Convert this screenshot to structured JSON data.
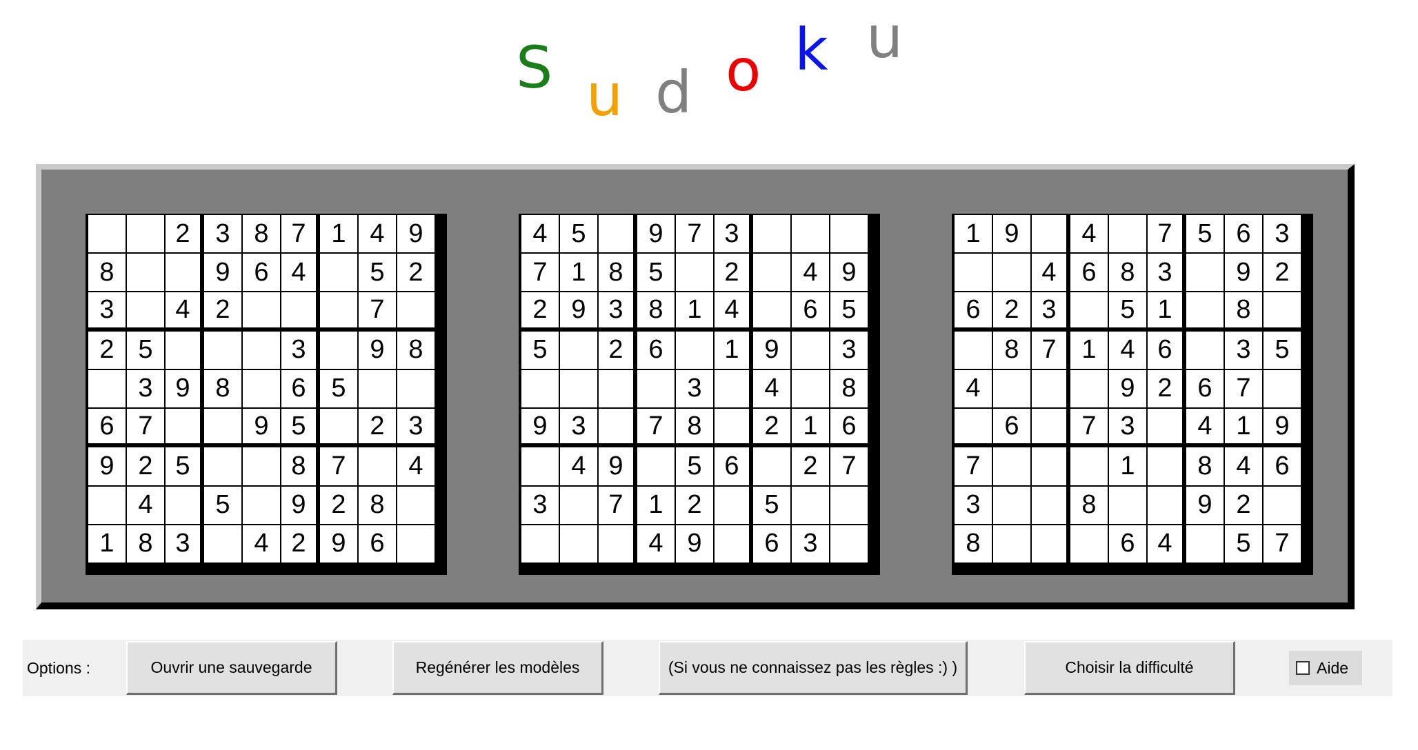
{
  "title": {
    "letters": [
      {
        "char": "S",
        "color": "#1a7f1a"
      },
      {
        "char": "u",
        "color": "#f5a000"
      },
      {
        "char": "d",
        "color": "#808080"
      },
      {
        "char": "o",
        "color": "#ee0000"
      },
      {
        "char": "k",
        "color": "#0a14ee"
      },
      {
        "char": "u",
        "color": "#808080"
      }
    ]
  },
  "grids": [
    [
      [
        "",
        "",
        "2",
        "3",
        "8",
        "7",
        "1",
        "4",
        "9"
      ],
      [
        "8",
        "",
        "",
        "9",
        "6",
        "4",
        "",
        "5",
        "2"
      ],
      [
        "3",
        "",
        "4",
        "2",
        "",
        "",
        "",
        "7",
        ""
      ],
      [
        "2",
        "5",
        "",
        "",
        "",
        "3",
        "",
        "9",
        "8"
      ],
      [
        "",
        "3",
        "9",
        "8",
        "",
        "6",
        "5",
        "",
        ""
      ],
      [
        "6",
        "7",
        "",
        "",
        "9",
        "5",
        "",
        "2",
        "3"
      ],
      [
        "9",
        "2",
        "5",
        "",
        "",
        "8",
        "7",
        "",
        "4"
      ],
      [
        "",
        "4",
        "",
        "5",
        "",
        "9",
        "2",
        "8",
        ""
      ],
      [
        "1",
        "8",
        "3",
        "",
        "4",
        "2",
        "9",
        "6",
        ""
      ]
    ],
    [
      [
        "4",
        "5",
        "",
        "9",
        "7",
        "3",
        "",
        "",
        ""
      ],
      [
        "7",
        "1",
        "8",
        "5",
        "",
        "2",
        "",
        "4",
        "9"
      ],
      [
        "2",
        "9",
        "3",
        "8",
        "1",
        "4",
        "",
        "6",
        "5"
      ],
      [
        "5",
        "",
        "2",
        "6",
        "",
        "1",
        "9",
        "",
        "3"
      ],
      [
        "",
        "",
        "",
        "",
        "3",
        "",
        "4",
        "",
        "8"
      ],
      [
        "9",
        "3",
        "",
        "7",
        "8",
        "",
        "2",
        "1",
        "6"
      ],
      [
        "",
        "4",
        "9",
        "",
        "5",
        "6",
        "",
        "2",
        "7"
      ],
      [
        "3",
        "",
        "7",
        "1",
        "2",
        "",
        "5",
        "",
        ""
      ],
      [
        "",
        "",
        "",
        "4",
        "9",
        "",
        "6",
        "3",
        ""
      ]
    ],
    [
      [
        "1",
        "9",
        "",
        "4",
        "",
        "7",
        "5",
        "6",
        "3"
      ],
      [
        "",
        "",
        "4",
        "6",
        "8",
        "3",
        "",
        "9",
        "2"
      ],
      [
        "6",
        "2",
        "3",
        "",
        "5",
        "1",
        "",
        "8",
        ""
      ],
      [
        "",
        "8",
        "7",
        "1",
        "4",
        "6",
        "",
        "3",
        "5"
      ],
      [
        "4",
        "",
        "",
        "",
        "9",
        "2",
        "6",
        "7",
        ""
      ],
      [
        "",
        "6",
        "",
        "7",
        "3",
        "",
        "4",
        "1",
        "9"
      ],
      [
        "7",
        "",
        "",
        "",
        "1",
        "",
        "8",
        "4",
        "6"
      ],
      [
        "3",
        "",
        "",
        "8",
        "",
        "",
        "9",
        "2",
        ""
      ],
      [
        "8",
        "",
        "",
        "",
        "6",
        "4",
        "",
        "5",
        "7"
      ]
    ]
  ],
  "toolbar": {
    "options_label": "Options :",
    "open_save_label": "Ouvrir une sauvegarde",
    "regenerate_label": "Regénérer les modèles",
    "rules_label": "(Si vous ne connaissez pas les règles :) )",
    "difficulty_label": "Choisir la difficulté",
    "help_label": "Aide",
    "help_checked": false
  }
}
